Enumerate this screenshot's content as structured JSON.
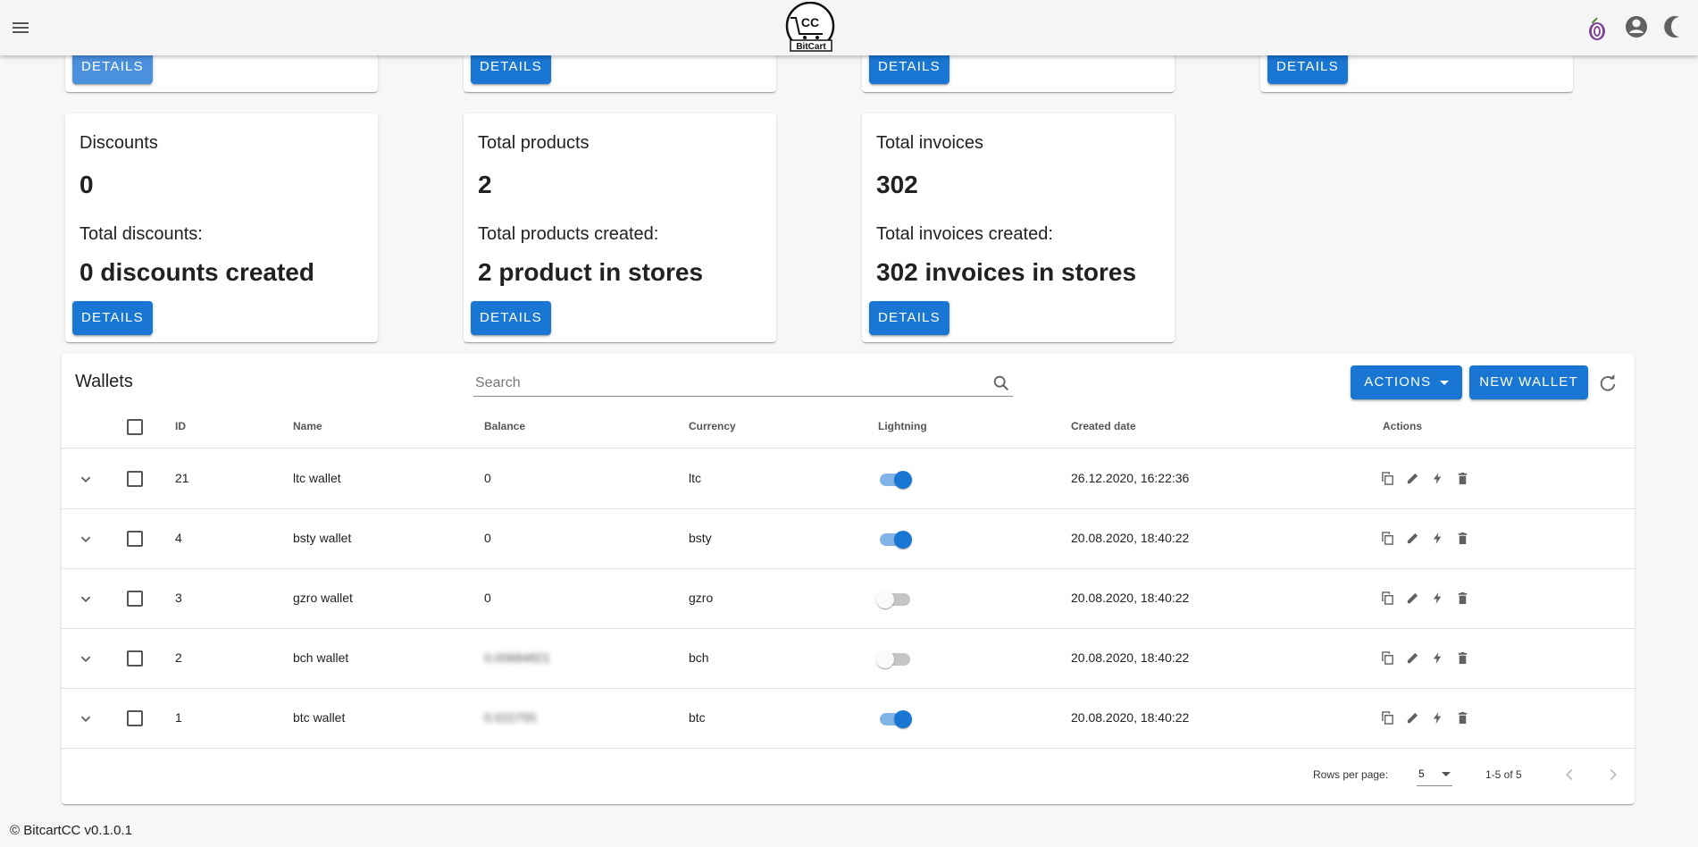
{
  "app": {
    "logo_text": "CC BitCart",
    "logo_cc": "CC",
    "logo_name": "BitCart"
  },
  "top_cards": [
    {
      "button": "DETAILS"
    },
    {
      "button": "DETAILS"
    },
    {
      "button": "DETAILS"
    },
    {
      "button": "DETAILS"
    }
  ],
  "cards": [
    {
      "title": "Discounts",
      "value": "0",
      "subtitle": "Total discounts:",
      "subvalue": "0 discounts created",
      "button": "DETAILS"
    },
    {
      "title": "Total products",
      "value": "2",
      "subtitle": "Total products created:",
      "subvalue": "2 product in stores",
      "button": "DETAILS"
    },
    {
      "title": "Total invoices",
      "value": "302",
      "subtitle": "Total invoices created:",
      "subvalue": "302 invoices in stores",
      "button": "DETAILS"
    }
  ],
  "wallets": {
    "title": "Wallets",
    "search_placeholder": "Search",
    "actions_label": "ACTIONS",
    "new_wallet_label": "NEW WALLET",
    "columns": [
      "ID",
      "Name",
      "Balance",
      "Currency",
      "Lightning",
      "Created date",
      "Actions"
    ],
    "rows": [
      {
        "id": "21",
        "name": "ltc wallet",
        "balance": "0",
        "balance_blurred": false,
        "currency": "ltc",
        "lightning": true,
        "created": "26.12.2020, 16:22:36"
      },
      {
        "id": "4",
        "name": "bsty wallet",
        "balance": "0",
        "balance_blurred": false,
        "currency": "bsty",
        "lightning": true,
        "created": "20.08.2020, 18:40:22"
      },
      {
        "id": "3",
        "name": "gzro wallet",
        "balance": "0",
        "balance_blurred": false,
        "currency": "gzro",
        "lightning": false,
        "created": "20.08.2020, 18:40:22"
      },
      {
        "id": "2",
        "name": "bch wallet",
        "balance": "0.00684821",
        "balance_blurred": true,
        "currency": "bch",
        "lightning": false,
        "created": "20.08.2020, 18:40:22"
      },
      {
        "id": "1",
        "name": "btc wallet",
        "balance": "0.022755",
        "balance_blurred": true,
        "currency": "btc",
        "lightning": true,
        "created": "20.08.2020, 18:40:22"
      }
    ],
    "rows_per_page_label": "Rows per page:",
    "rows_per_page_value": "5",
    "range_text": "1-5 of 5"
  },
  "footer": {
    "copyright": "© BitcartCC v0.1.0.1"
  },
  "colors": {
    "primary": "#1976d2",
    "topbar": "#f5f5f5",
    "background": "#f7f7f7"
  },
  "icons": {
    "menu": "menu-icon",
    "tor": "tor-onion-icon",
    "account": "account-circle-icon",
    "theme": "moon-icon",
    "search": "search-icon",
    "refresh": "refresh-icon",
    "expand": "chevron-down-icon",
    "row_actions": [
      "copy-icon",
      "pencil-icon",
      "lightning-icon",
      "delete-icon"
    ]
  }
}
